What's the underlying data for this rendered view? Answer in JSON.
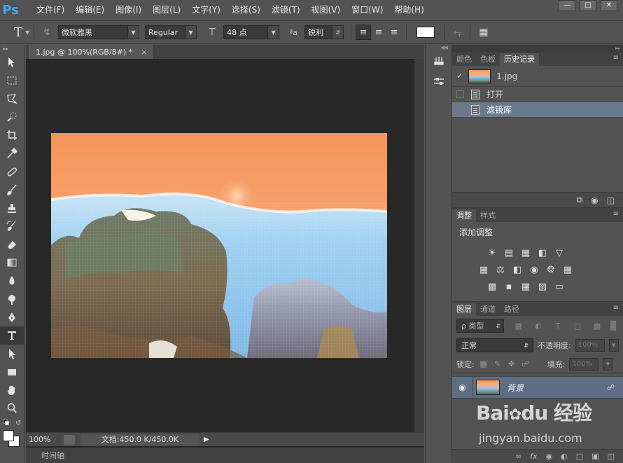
{
  "app": {
    "logo": "Ps"
  },
  "menu": [
    "文件(F)",
    "编辑(E)",
    "图像(I)",
    "图层(L)",
    "文字(Y)",
    "选择(S)",
    "滤镜(T)",
    "视图(V)",
    "窗口(W)",
    "帮助(H)"
  ],
  "options": {
    "font_family": "微软雅黑",
    "font_style": "Regular",
    "font_size": "48 点",
    "aa_label": "ªa",
    "antialias": "锐利"
  },
  "document": {
    "tab_title": "1.jpg @ 100%(RGB/8#) *",
    "zoom": "100%",
    "doc_info": "文档:450.0 K/450.0K",
    "timeline": "时间轴"
  },
  "history": {
    "tabs": [
      "颜色",
      "色板",
      "历史记录"
    ],
    "snapshot_name": "1.jpg",
    "states": [
      "打开",
      "滤镜库"
    ]
  },
  "adjustments": {
    "tabs": [
      "调整",
      "样式"
    ],
    "title": "添加调整"
  },
  "layers": {
    "tabs": [
      "图层",
      "通道",
      "路径"
    ],
    "filter_kind": "ρ 类型",
    "blend_mode": "正常",
    "opacity_label": "不透明度:",
    "opacity_value": "100%",
    "lock_label": "锁定:",
    "fill_label": "填充:",
    "fill_value": "100%",
    "layer_name": "背景"
  },
  "watermark": {
    "logo": "Bai du 经验",
    "url": "jingyan.baidu.com"
  }
}
